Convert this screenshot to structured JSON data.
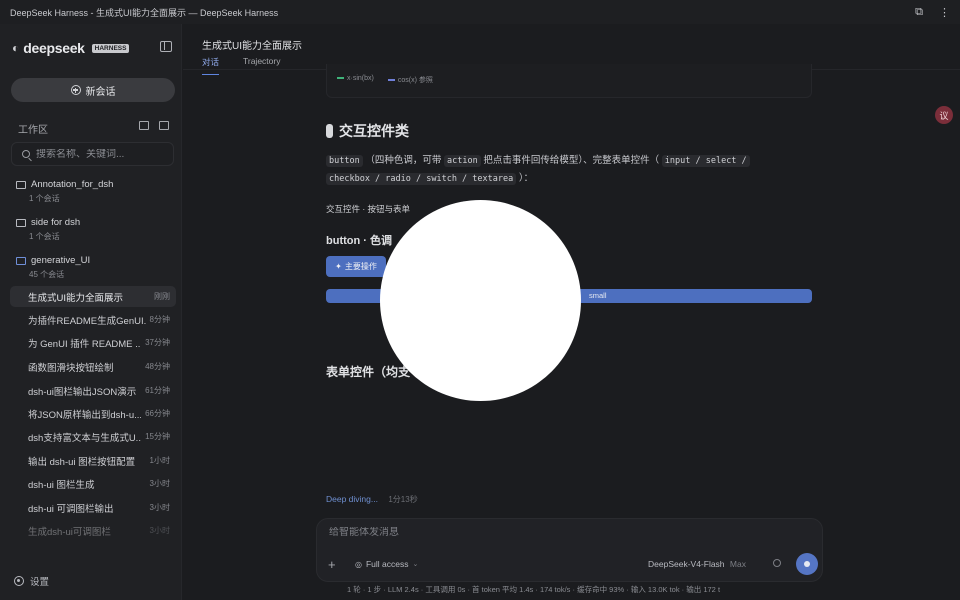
{
  "window": {
    "title": "DeepSeek Harness - 生成式UI能力全面展示 — DeepSeek Harness"
  },
  "sidebar": {
    "logo_text": "deepseek",
    "logo_badge": "HARNESS",
    "new_chat_label": "新会话",
    "workspace_label": "工作区",
    "search_placeholder": "搜索名称、关键词...",
    "folders": [
      {
        "name": "Annotation_for_dsh",
        "count": "1 个会话"
      },
      {
        "name": "side for dsh",
        "count": "1 个会话"
      },
      {
        "name": "generative_UI",
        "count": "45 个会话"
      }
    ],
    "chats": [
      {
        "title": "生成式UI能力全面展示",
        "time": "刚刚"
      },
      {
        "title": "为插件README生成GenUI...",
        "time": "8分钟"
      },
      {
        "title": "为 GenUI 插件 README ...",
        "time": "37分钟"
      },
      {
        "title": "函数图滑块按钮绘制",
        "time": "48分钟"
      },
      {
        "title": "dsh-ui图栏输出JSON演示",
        "time": "61分钟"
      },
      {
        "title": "将JSON原样输出到dsh-u...",
        "time": "66分钟"
      },
      {
        "title": "dsh支持富文本与生成式U...",
        "time": "15分钟"
      },
      {
        "title": "输出 dsh-ui 图栏按钮配置",
        "time": "1小时"
      },
      {
        "title": "dsh-ui 图栏生成",
        "time": "3小时"
      },
      {
        "title": "dsh-ui 可调图栏输出",
        "time": "3小时"
      },
      {
        "title": "生成dsh-ui可调图栏",
        "time": "3小时"
      }
    ],
    "settings_label": "设置"
  },
  "main": {
    "page_title": "生成式UI能力全面展示",
    "tabs": [
      {
        "label": "对话"
      },
      {
        "label": "Trajectory"
      }
    ],
    "legend": [
      {
        "label": "x·sin(bx)",
        "color": "#3fb37a"
      },
      {
        "label": "cos(x) 参照",
        "color": "#6f7fd8"
      }
    ],
    "section_title": "交互控件类",
    "para": {
      "c1": "button",
      "t1": "（四种色调，可带",
      "c2": "action",
      "t2": "把点击事件回传给模型）、完整表单控件（",
      "c3": "input / select /",
      "c4": "checkbox / radio / switch / textarea",
      "t3": "）："
    },
    "subhead": "交互控件 · 按钮与表单",
    "button_heading": "button · 色调",
    "primary_button": "主要操作",
    "bar_button_label": "small",
    "form_heading": "表单控件（均支",
    "footnote": "Deep diving...",
    "footnote_time": "1分13秒",
    "avatar_text": "议"
  },
  "composer": {
    "placeholder": "给智能体发消息",
    "access_label": "Full access",
    "model_name": "DeepSeek-V4-Flash",
    "model_mode": "Max",
    "status_line": "1 轮 · 1 步 · LLM 2.4s · 工具调用 0s · 首 token 平均 1.4s · 174 tok/s · 缓存命中 93% · 输入 13.0K tok · 输出 172 t"
  },
  "colors": {
    "accent": "#5575c4",
    "bg": "#1b1c1f",
    "sidebar": "#202124"
  }
}
